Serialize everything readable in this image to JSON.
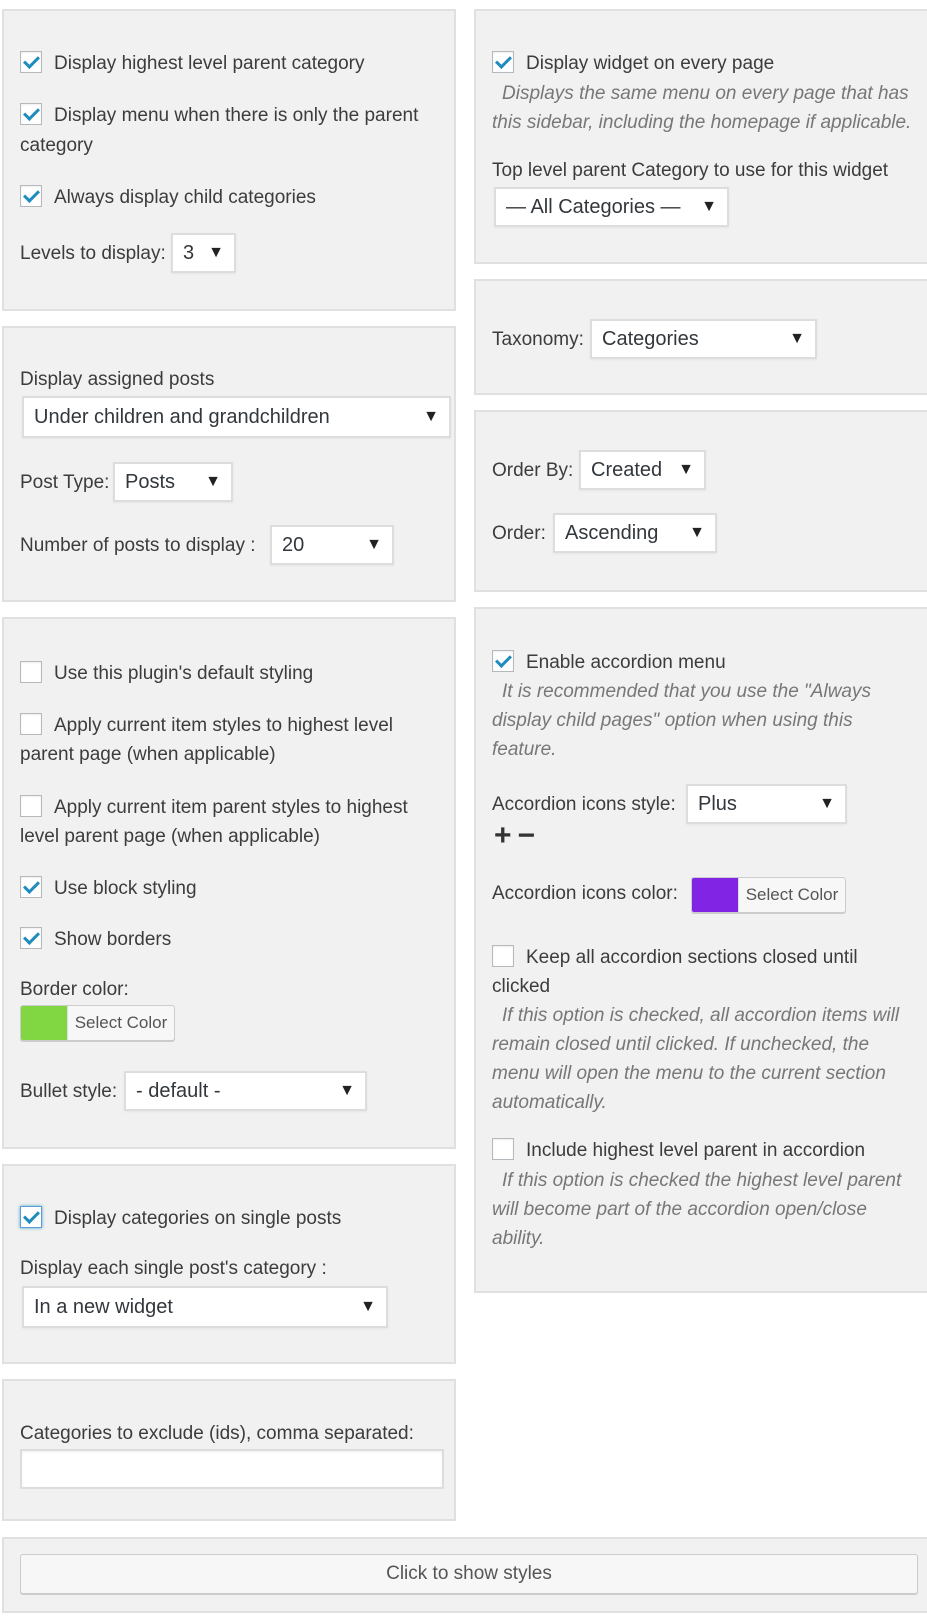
{
  "p1": {
    "cb_highest": {
      "label": "Display highest level parent category",
      "checked": true
    },
    "cb_only_parent": {
      "label_line1": "Display menu when there is only the parent",
      "label_line2": "category",
      "checked": true
    },
    "cb_always_child": {
      "label": "Always display child categories",
      "checked": true
    },
    "levels_label": "Levels to display:",
    "levels_value": "3"
  },
  "p2": {
    "assigned_label": "Display assigned posts",
    "assigned_value": "Under children and grandchildren",
    "post_type_label": "Post Type:",
    "post_type_value": "Posts",
    "num_label": "Number of posts to display :",
    "num_value": "20"
  },
  "p3": {
    "cb_default_styling": {
      "label": "Use this plugin's default styling",
      "checked": false
    },
    "cb_current_item": {
      "label_line1": "Apply current item styles to highest level",
      "label_line2": "parent page (when applicable)",
      "checked": false
    },
    "cb_current_parent": {
      "label_line1": "Apply current item parent styles to highest",
      "label_line2": "level parent page (when applicable)",
      "checked": false
    },
    "cb_block": {
      "label": "Use block styling",
      "checked": true
    },
    "cb_borders": {
      "label": "Show borders",
      "checked": true
    },
    "border_color_label": "Border color:",
    "border_color": "#81d742",
    "select_color": "Select Color",
    "bullet_label": "Bullet style:",
    "bullet_value": "- default -"
  },
  "p4": {
    "cb_single": {
      "label": "Display categories on single posts",
      "checked": true
    },
    "each_label": "Display each single post's category :",
    "each_value": "In a new widget"
  },
  "p5": {
    "exclude_label": "Categories to exclude (ids), comma separated:",
    "exclude_value": ""
  },
  "r1": {
    "cb_every_page": {
      "label": "Display widget on every page",
      "checked": true
    },
    "desc_line1": "Displays the same menu on every page that has",
    "desc_line2": "this sidebar, including the homepage if applicable.",
    "top_label": "Top level parent Category to use for this widget",
    "top_value": "— All Categories —"
  },
  "r2": {
    "taxonomy_label": "Taxonomy:",
    "taxonomy_value": "Categories"
  },
  "r3": {
    "order_by_label": "Order By:",
    "order_by_value": "Created",
    "order_label": "Order:",
    "order_value": "Ascending"
  },
  "r4": {
    "cb_accordion": {
      "label": "Enable accordion menu",
      "checked": true
    },
    "acc_desc_line1": "It is recommended that you use the \"Always",
    "acc_desc_line2": "display child pages\" option when using this",
    "acc_desc_line3": "feature.",
    "icons_style_label": "Accordion icons style:",
    "icons_style_value": "Plus",
    "icon_plus": "+",
    "icon_minus": "−",
    "icons_color_label": "Accordion icons color:",
    "icons_color": "#8224e3",
    "select_color": "Select Color",
    "cb_closed": {
      "label_line1": "Keep all accordion sections closed until",
      "label_line2": "clicked",
      "checked": false
    },
    "closed_desc_line1": "If this option is checked, all accordion items will",
    "closed_desc_line2": "remain closed until clicked. If unchecked, the",
    "closed_desc_line3": "menu will open the menu to the current section",
    "closed_desc_line4": "automatically.",
    "cb_include_parent": {
      "label": "Include highest level parent in accordion",
      "checked": false
    },
    "inc_desc_line1": "If this option is checked the highest level parent",
    "inc_desc_line2": "will become part of the accordion open/close",
    "inc_desc_line3": "ability."
  },
  "show_styles_button": "Click to show styles",
  "icons": {
    "dropdown": "▼"
  }
}
